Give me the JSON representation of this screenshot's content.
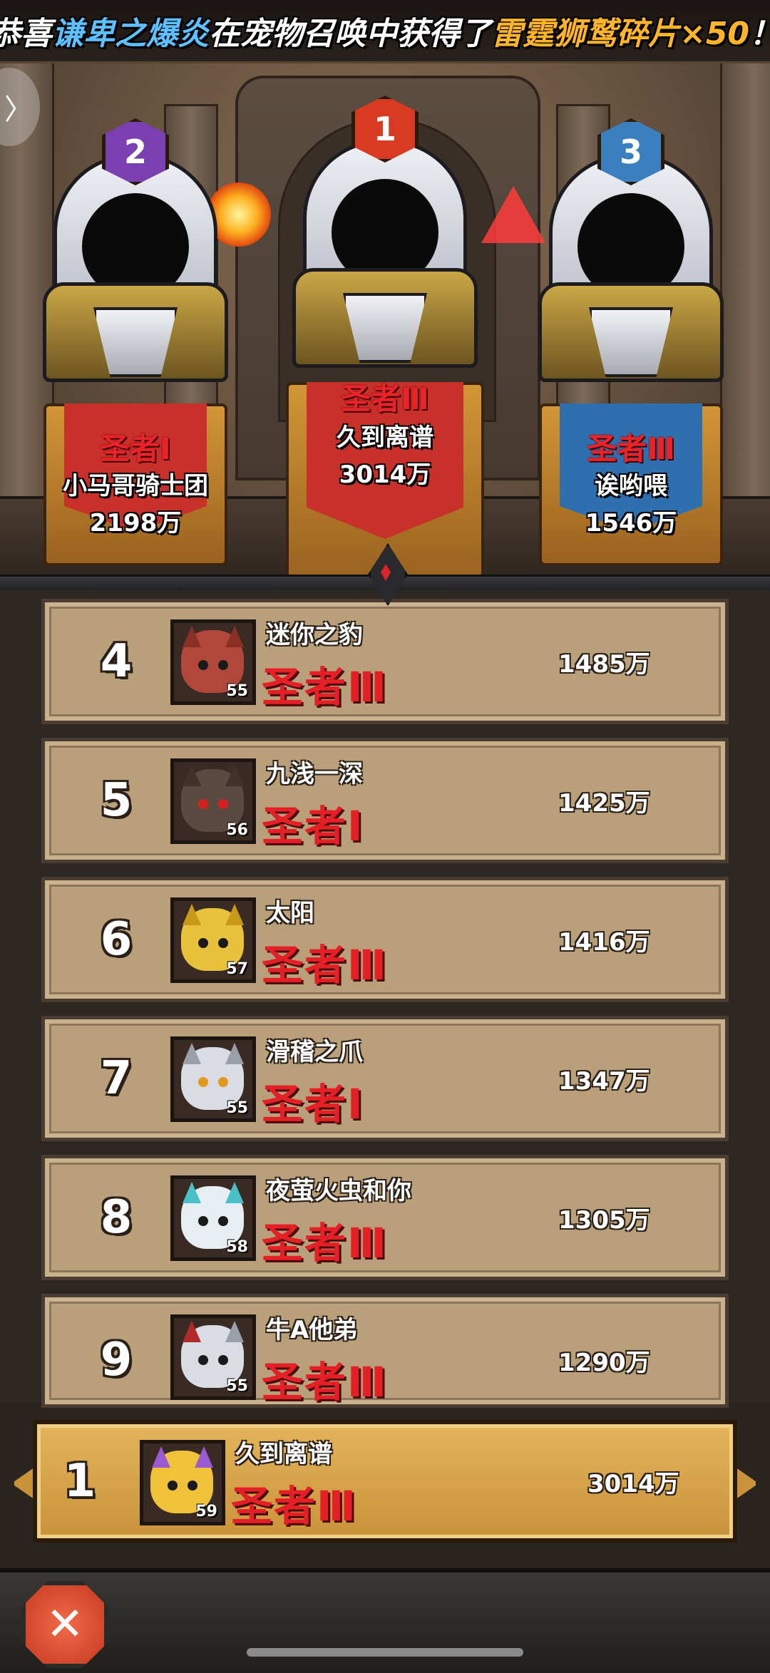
{
  "banner": {
    "prefix": "恭喜",
    "player": "谦卑之爆炎",
    "middle": "在宠物召唤中获得了",
    "item": "雷霆狮鹫碎片×50",
    "suffix": "！"
  },
  "podium": [
    {
      "rank": "2",
      "title": "圣者Ⅰ",
      "name": "小马哥骑士团",
      "score": "2198万",
      "badge_color": "#7a3fb0",
      "banner_color": "#c8312a"
    },
    {
      "rank": "1",
      "title": "圣者Ⅲ",
      "name": "久到离谱",
      "score": "3014万",
      "badge_color": "#d83a22",
      "banner_color": "#c8312a"
    },
    {
      "rank": "3",
      "title": "圣者Ⅲ",
      "name": "诶哟喂",
      "score": "1546万",
      "badge_color": "#3a7fc0",
      "banner_color": "#2e6fb0"
    }
  ],
  "ranking": [
    {
      "rank": "4",
      "name": "迷你之豹",
      "level": "55",
      "title": "圣者Ⅲ",
      "score": "1485万",
      "avatar_color": "#b0473a",
      "avatar_icon": "leopard-pet-icon"
    },
    {
      "rank": "5",
      "name": "九浅一深",
      "level": "56",
      "title": "圣者Ⅰ",
      "score": "1425万",
      "avatar_color": "#5a4a40",
      "avatar_icon": "hooded-pet-icon"
    },
    {
      "rank": "6",
      "name": "太阳",
      "level": "57",
      "title": "圣者Ⅲ",
      "score": "1416万",
      "avatar_color": "#e8c23a",
      "avatar_icon": "fox-pet-icon"
    },
    {
      "rank": "7",
      "name": "滑稽之爪",
      "level": "55",
      "title": "圣者Ⅰ",
      "score": "1347万",
      "avatar_color": "#d9dce2",
      "avatar_icon": "lion-pet-icon"
    },
    {
      "rank": "8",
      "name": "夜萤火虫和你",
      "level": "58",
      "title": "圣者Ⅲ",
      "score": "1305万",
      "avatar_color": "#e6eef2",
      "avatar_icon": "deer-pet-icon"
    },
    {
      "rank": "9",
      "name": "牛A他弟",
      "level": "55",
      "title": "圣者Ⅲ",
      "score": "1290万",
      "avatar_color": "#d9dce2",
      "avatar_icon": "lion-pet-icon"
    }
  ],
  "self": {
    "rank": "1",
    "name": "久到离谱",
    "level": "59",
    "title": "圣者Ⅲ",
    "score": "3014万",
    "avatar_color": "#f0c23a",
    "avatar_icon": "fox-pet-icon"
  },
  "controls": {
    "close_icon": "close-icon",
    "close_glyph": "✕",
    "side_arrow_glyph": "〉"
  }
}
